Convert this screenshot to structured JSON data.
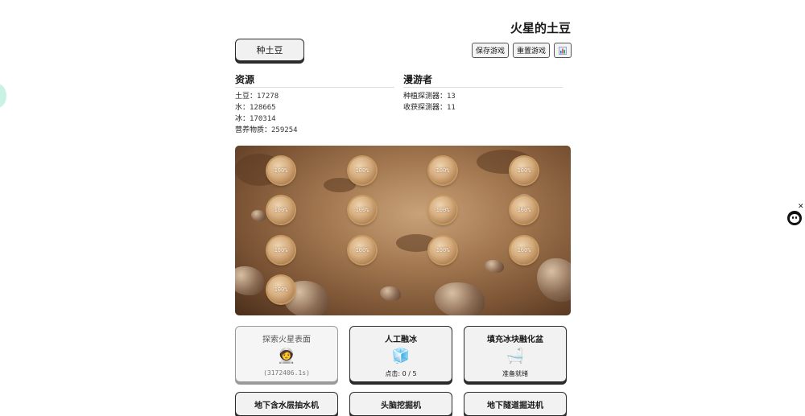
{
  "header": {
    "title": "火星的土豆",
    "plant_label": "种土豆",
    "save_label": "保存游戏",
    "reset_label": "重置游戏",
    "stats_icon": "bar-chart-icon"
  },
  "resources": {
    "heading": "资源",
    "items": [
      {
        "label": "土豆：",
        "value": "17278"
      },
      {
        "label": "水：",
        "value": "128665"
      },
      {
        "label": "冰：",
        "value": "170314"
      },
      {
        "label": "营养物质：",
        "value": "259254"
      }
    ]
  },
  "rovers": {
    "heading": "漫游者",
    "items": [
      {
        "label": "种植探测器：",
        "value": "13"
      },
      {
        "label": "收获探测器：",
        "value": "11"
      }
    ]
  },
  "field": {
    "plots": [
      "100%",
      "100%",
      "100%",
      "100%",
      "100%",
      "100%",
      "100%",
      "100%",
      "100%",
      "100%",
      "100%",
      "100%",
      "100%"
    ]
  },
  "actions": [
    {
      "title": "探索火星表面",
      "icon": "🧑‍🚀",
      "icon_name": "astronaut-icon",
      "status": "(3172406.1s)",
      "disabled": true
    },
    {
      "title": "人工融冰",
      "icon": "🧊",
      "icon_name": "ice-cube-icon",
      "status": "点击: 0 / 5",
      "disabled": false
    },
    {
      "title": "填充冰块融化盆",
      "icon": "🛁",
      "icon_name": "bathtub-icon",
      "status": "准备就绪",
      "disabled": false
    },
    {
      "title": "地下含水层抽水机",
      "disabled": false
    },
    {
      "title": "头脑挖掘机",
      "disabled": false
    },
    {
      "title": "地下隧道掘进机",
      "disabled": false
    }
  ],
  "colors": {
    "accent_border": "#2b2b2b",
    "mars_soil": "#a57a52"
  }
}
